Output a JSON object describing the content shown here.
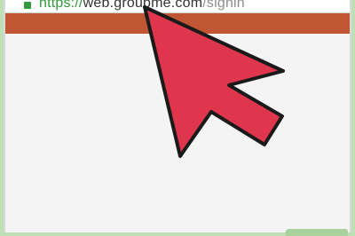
{
  "browser": {
    "url_scheme": "https://",
    "url_host": "web.groupme.com",
    "url_path": "/signin",
    "lock_icon": "lock-icon"
  },
  "colors": {
    "header": "#c05634",
    "secure_green": "#2e9a3a",
    "background_frame": "#bfe0b4",
    "cursor_fill": "#e0364d"
  },
  "overlay": {
    "icon": "large-arrow-cursor-icon"
  }
}
